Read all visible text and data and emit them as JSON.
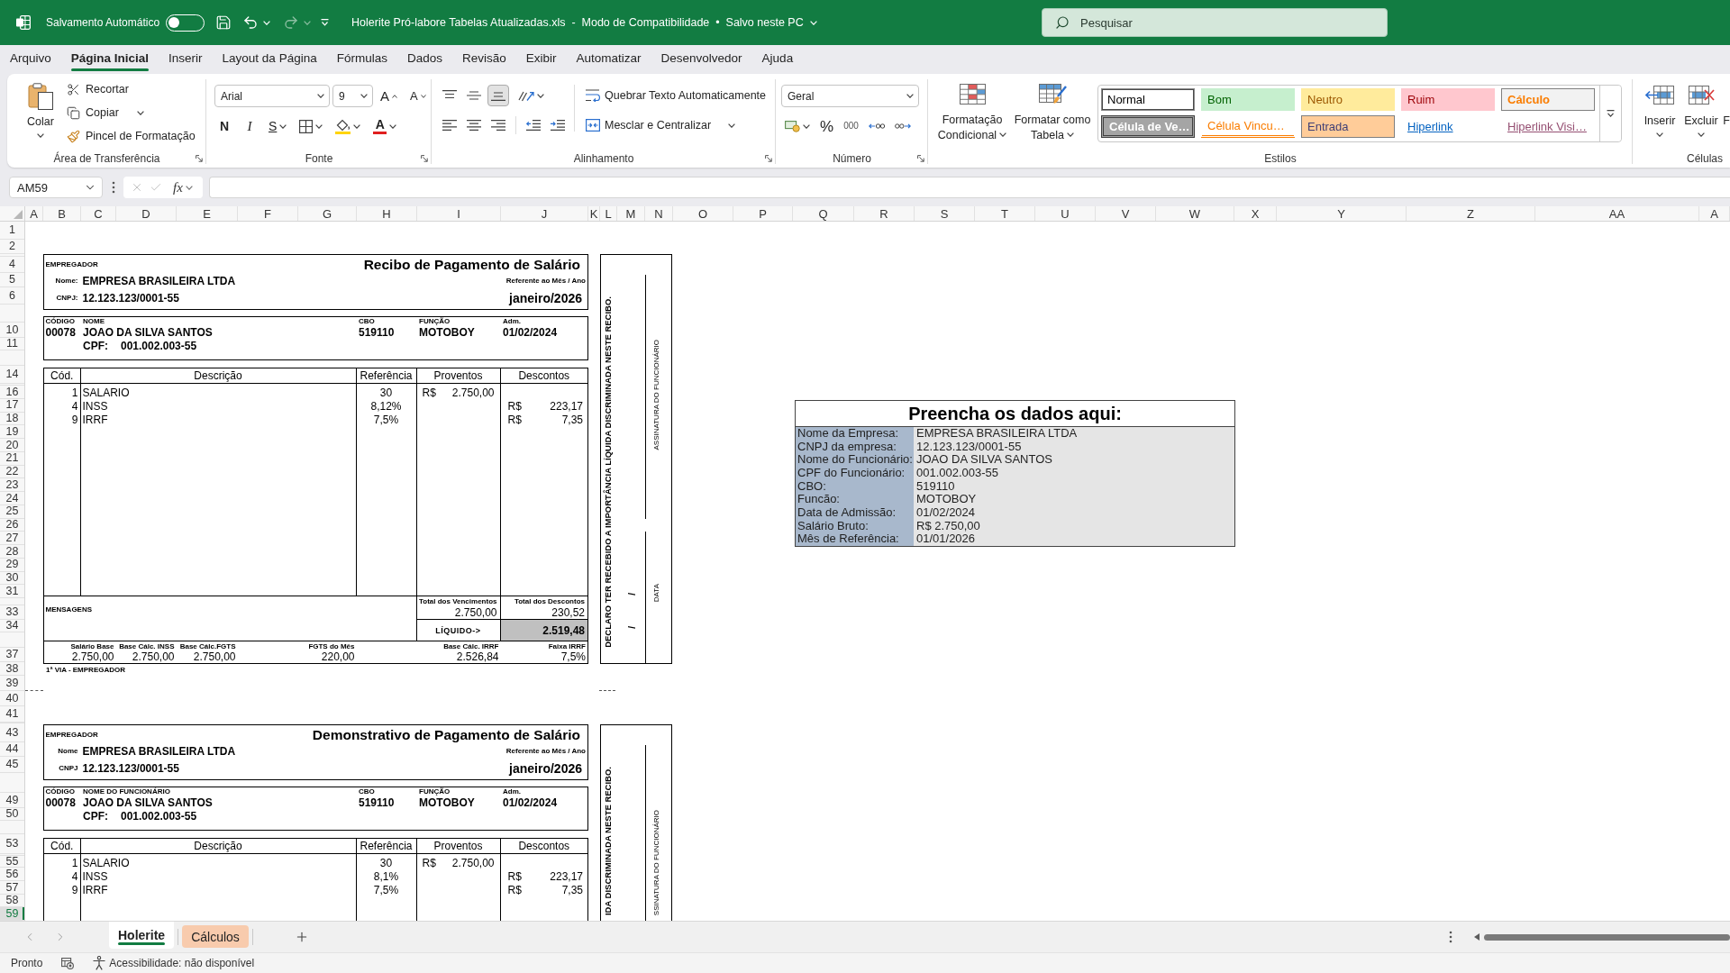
{
  "title_bar": {
    "autosave_label": "Salvamento Automático",
    "autosave_on": false,
    "redo_disabled": true,
    "document_title": "Holerite Pró-labore Tabelas Atualizadas.xls  -  Modo de Compatibilidade  •  Salvo neste PC",
    "search_placeholder": "Pesquisar"
  },
  "menu_tabs": [
    {
      "label": "Arquivo",
      "selected": false
    },
    {
      "label": "Página Inicial",
      "selected": true
    },
    {
      "label": "Inserir",
      "selected": false
    },
    {
      "label": "Layout da Página",
      "selected": false
    },
    {
      "label": "Fórmulas",
      "selected": false
    },
    {
      "label": "Dados",
      "selected": false
    },
    {
      "label": "Revisão",
      "selected": false
    },
    {
      "label": "Exibir",
      "selected": false
    },
    {
      "label": "Automatizar",
      "selected": false
    },
    {
      "label": "Desenvolvedor",
      "selected": false
    },
    {
      "label": "Ajuda",
      "selected": false
    }
  ],
  "ribbon": {
    "clipboard": {
      "label": "Área de Transferência",
      "paste": "Colar",
      "cut": "Recortar",
      "copy": "Copiar",
      "format_painter": "Pincel de Formatação"
    },
    "font": {
      "label": "Fonte",
      "font_name": "Arial",
      "font_size": "9",
      "grow": "A",
      "shrink": "A",
      "bold": "N",
      "italic": "I",
      "underline": "S",
      "font_color": "A"
    },
    "alignment": {
      "label": "Alinhamento",
      "vertical": [
        {
          "kind": "top",
          "selected": false
        },
        {
          "kind": "middle",
          "selected": false
        },
        {
          "kind": "bottom",
          "selected": true
        }
      ],
      "wrap_text": "Quebrar Texto Automaticamente",
      "merge": "Mesclar e Centralizar"
    },
    "number": {
      "label": "Número",
      "format": "Geral",
      "percent": "%",
      "thousands": "000"
    },
    "styles": {
      "label": "Estilos",
      "conditional": [
        "Formatação",
        "Condicional"
      ],
      "table": [
        "Formatar como",
        "Tabela"
      ],
      "gallery": [
        {
          "label": "Normal",
          "kind": "normal",
          "selected": true
        },
        {
          "label": "Bom",
          "kind": "good",
          "selected": false
        },
        {
          "label": "Neutro",
          "kind": "neutral",
          "selected": false
        },
        {
          "label": "Ruim",
          "kind": "bad",
          "selected": false
        },
        {
          "label": "Cálculo",
          "kind": "calculation",
          "selected": false
        },
        {
          "label": "Célula de Ve…",
          "kind": "check",
          "selected": false
        },
        {
          "label": "Célula Vincu…",
          "kind": "linked",
          "selected": false
        },
        {
          "label": "Entrada",
          "kind": "input",
          "selected": false
        },
        {
          "label": "Hiperlink",
          "kind": "hyperlink",
          "selected": false
        },
        {
          "label": "Hiperlink Visi…",
          "kind": "followed_hyperlink",
          "selected": false
        }
      ]
    },
    "cells": {
      "label": "Células",
      "insert": "Inserir",
      "delete": "Excluir",
      "format": "F"
    }
  },
  "formula_bar": {
    "name_box": "AM59",
    "function_label": "fx",
    "confirm_disabled": true
  },
  "sheet": {
    "column_headers": [
      "A",
      "B",
      "C",
      "D",
      "E",
      "F",
      "G",
      "H",
      "I",
      "J",
      "K",
      "L",
      "M",
      "N",
      "O",
      "P",
      "Q",
      "R",
      "S",
      "T",
      "U",
      "V",
      "W",
      "X",
      "Y",
      "Z",
      "AA",
      "A"
    ],
    "row_headers": [
      {
        "label": "1",
        "selected": false
      },
      {
        "label": "2",
        "selected": false
      },
      {
        "label": "4",
        "selected": false
      },
      {
        "label": "5",
        "selected": false
      },
      {
        "label": "6",
        "selected": false
      },
      {
        "label": "10",
        "selected": false
      },
      {
        "label": "11",
        "selected": false
      },
      {
        "label": "14",
        "selected": false
      },
      {
        "label": "16",
        "selected": false
      },
      {
        "label": "17",
        "selected": false
      },
      {
        "label": "18",
        "selected": false
      },
      {
        "label": "19",
        "selected": false
      },
      {
        "label": "20",
        "selected": false
      },
      {
        "label": "21",
        "selected": false
      },
      {
        "label": "22",
        "selected": false
      },
      {
        "label": "23",
        "selected": false
      },
      {
        "label": "24",
        "selected": false
      },
      {
        "label": "25",
        "selected": false
      },
      {
        "label": "26",
        "selected": false
      },
      {
        "label": "27",
        "selected": false
      },
      {
        "label": "28",
        "selected": false
      },
      {
        "label": "29",
        "selected": false
      },
      {
        "label": "30",
        "selected": false
      },
      {
        "label": "31",
        "selected": false
      },
      {
        "label": "33",
        "selected": false
      },
      {
        "label": "34",
        "selected": false
      },
      {
        "label": "37",
        "selected": false
      },
      {
        "label": "38",
        "selected": false
      },
      {
        "label": "39",
        "selected": false
      },
      {
        "label": "40",
        "selected": false
      },
      {
        "label": "41",
        "selected": false
      },
      {
        "label": "43",
        "selected": false
      },
      {
        "label": "44",
        "selected": false
      },
      {
        "label": "45",
        "selected": false
      },
      {
        "label": "49",
        "selected": false
      },
      {
        "label": "50",
        "selected": false
      },
      {
        "label": "53",
        "selected": false
      },
      {
        "label": "55",
        "selected": false
      },
      {
        "label": "56",
        "selected": false
      },
      {
        "label": "57",
        "selected": false
      },
      {
        "label": "58",
        "selected": false
      },
      {
        "label": "59",
        "selected": true
      }
    ],
    "payslips": [
      {
        "header": {
          "employer_label": "EMPREGADOR",
          "name_label": "Nome:",
          "company": "EMPRESA BRASILEIRA LTDA",
          "cnpj_label": "CNPJ:",
          "cnpj": "12.123.123/0001-55",
          "title": "Recibo de Pagamento de Salário",
          "period_label": "Referente ao Mês / Ano",
          "period": "janeiro/2026"
        },
        "employee": {
          "code_label": "CÓDIGO",
          "name_label": "NOME",
          "cbo_label": "CBO",
          "role_label": "FUNÇÃO",
          "admission_label": "Adm.",
          "code": "00078",
          "name": "JOAO DA SILVA SANTOS",
          "cbo": "519110",
          "role": "MOTOBOY",
          "admission": "01/02/2024",
          "cpf_label": "CPF:",
          "cpf": "001.002.003-55"
        },
        "items": {
          "columns": [
            "Cód.",
            "Descrição",
            "Referência",
            "Proventos",
            "Descontos"
          ],
          "rows": [
            {
              "code": "1",
              "description": "SALARIO",
              "reference": "30",
              "earning": {
                "currency": "R$",
                "amount": "2.750,00"
              }
            },
            {
              "code": "4",
              "description": "INSS",
              "reference": "8,12%",
              "deduction": {
                "currency": "R$",
                "amount": "223,17"
              }
            },
            {
              "code": "9",
              "description": "IRRF",
              "reference": "7,5%",
              "deduction": {
                "currency": "R$",
                "amount": "7,35"
              }
            }
          ]
        },
        "totals": {
          "messages_label": "MENSAGENS",
          "earnings_label": "Total dos Vencimentos",
          "earnings": "2.750,00",
          "deductions_label": "Total dos Descontos",
          "deductions": "230,52",
          "net_label": "LÍQUIDO->",
          "net": "2.519,48"
        },
        "bases": [
          {
            "label": "Salário Base",
            "value": "2.750,00"
          },
          {
            "label": "Base Cálc. INSS",
            "value": "2.750,00"
          },
          {
            "label": "Base Cálc.FGTS",
            "value": "2.750,00"
          },
          {
            "label": "FGTS do Mês",
            "value": "220,00"
          },
          {
            "label": "Base Cálc. IRRF",
            "value": "2.526,84"
          },
          {
            "label": "Faixa IRRF",
            "value": "7,5%"
          }
        ],
        "copy_note": "1ª VIA - EMPREGADOR",
        "receipt": {
          "declaration": "DECLARO TER RECEBIDO A IMPORTÂNCIA LÍQUIDA DISCRIMINADA NESTE RECIBO.",
          "date_marks": [
            "/",
            "/"
          ],
          "signature_label": "ASSINATURA DO FUNCIONÁRIO",
          "date_label": "DATA"
        }
      },
      {
        "header": {
          "employer_label": "EMPREGADOR",
          "name_label": "Nome",
          "company": "EMPRESA BRASILEIRA LTDA",
          "cnpj_label": "CNPJ",
          "cnpj": "12.123.123/0001-55",
          "title": "Demonstrativo de Pagamento de Salário",
          "period_label": "Referente ao Mês / Ano",
          "period": "janeiro/2026"
        },
        "employee": {
          "code_label": "CÓDIGO",
          "name_label": "NOME DO FUNCIONÁRIO",
          "cbo_label": "CBO",
          "role_label": "FUNÇÃO",
          "admission_label": "Adm.",
          "code": "00078",
          "name": "JOAO DA SILVA SANTOS",
          "cbo": "519110",
          "role": "MOTOBOY",
          "admission": "01/02/2024",
          "cpf_label": "CPF:",
          "cpf": "001.002.003-55"
        },
        "items": {
          "columns": [
            "Cód.",
            "Descrição",
            "Referência",
            "Proventos",
            "Descontos"
          ],
          "rows": [
            {
              "code": "1",
              "description": "SALARIO",
              "reference": "30",
              "earning": {
                "currency": "R$",
                "amount": "2.750,00"
              }
            },
            {
              "code": "4",
              "description": "INSS",
              "reference": "8,1%",
              "deduction": {
                "currency": "R$",
                "amount": "223,17"
              }
            },
            {
              "code": "9",
              "description": "IRRF",
              "reference": "7,5%",
              "deduction": {
                "currency": "R$",
                "amount": "7,35"
              }
            }
          ]
        },
        "receipt": {
          "declaration": "IDA DISCRIMINADA NESTE RECIBO.",
          "signature_label": "SSINATURA DO FUNCIONÁRIO"
        }
      }
    ],
    "data_panel": {
      "title": "Preencha os dados aqui:",
      "rows": [
        {
          "label": "Nome da Empresa:",
          "value": "EMPRESA BRASILEIRA LTDA"
        },
        {
          "label": "CNPJ da empresa:",
          "value": "12.123.123/0001-55"
        },
        {
          "label": "Nome do Funcionário:",
          "value": "JOAO DA SILVA SANTOS"
        },
        {
          "label": "CPF do Funcionário:",
          "value": "001.002.003-55"
        },
        {
          "label": "CBO:",
          "value": "519110"
        },
        {
          "label": "Funcão:",
          "value": "MOTOBOY"
        },
        {
          "label": "Data de Admissão:",
          "value": "01/02/2024"
        },
        {
          "label": "Salário Bruto:",
          "value": "R$ 2.750,00"
        },
        {
          "label": "Mês de Referência:",
          "value": "01/01/2026"
        }
      ]
    }
  },
  "sheet_tabs": [
    {
      "label": "Holerite",
      "selected": true
    },
    {
      "label": "Cálculos",
      "selected": false,
      "color": "#f8cbad"
    }
  ],
  "status_bar": {
    "status": "Pronto",
    "accessibility": "Acessibilidade: não disponível"
  }
}
